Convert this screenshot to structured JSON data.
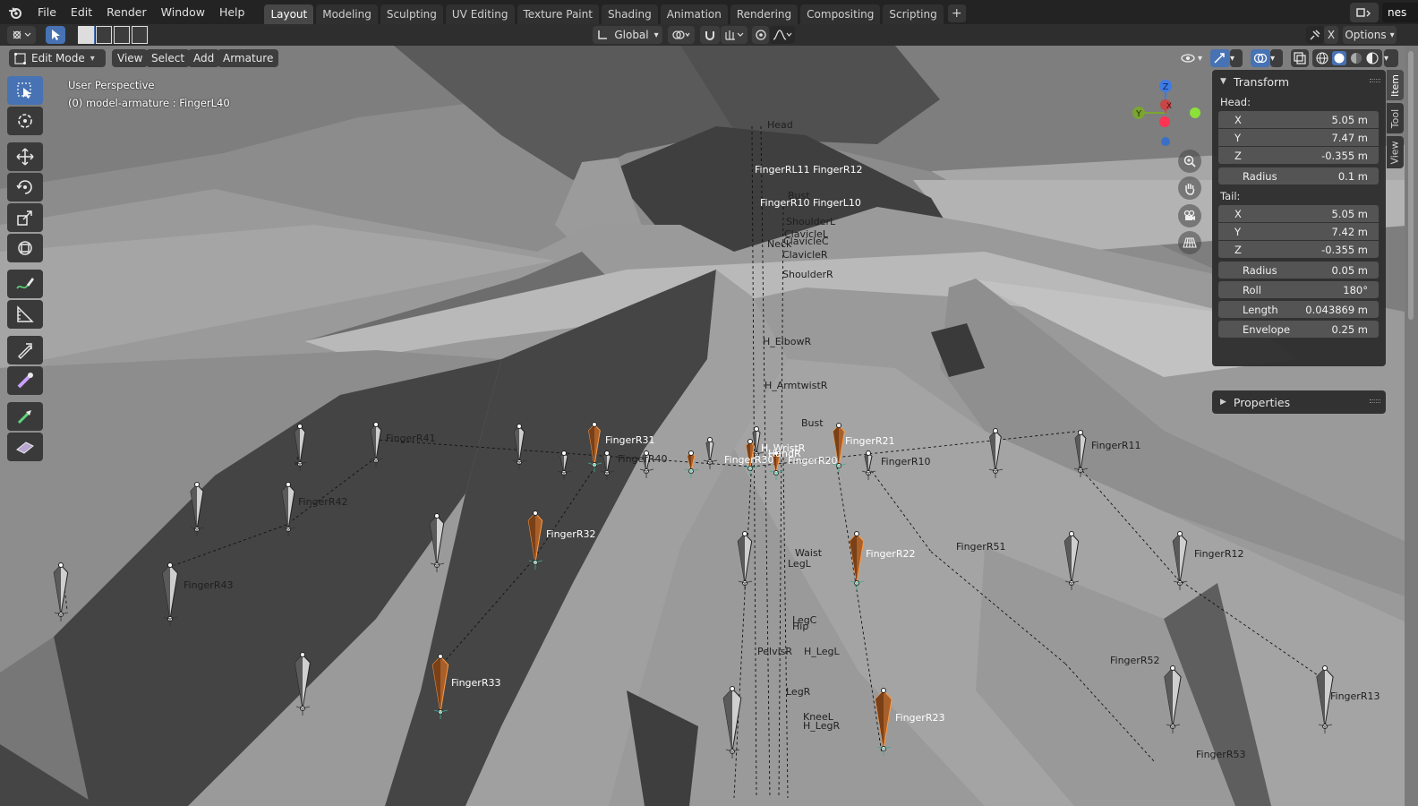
{
  "menu": [
    "File",
    "Edit",
    "Render",
    "Window",
    "Help"
  ],
  "workspaces": [
    {
      "label": "Layout",
      "active": true
    },
    {
      "label": "Modeling",
      "active": false
    },
    {
      "label": "Sculpting",
      "active": false
    },
    {
      "label": "UV Editing",
      "active": false
    },
    {
      "label": "Texture Paint",
      "active": false
    },
    {
      "label": "Shading",
      "active": false
    },
    {
      "label": "Animation",
      "active": false
    },
    {
      "label": "Rendering",
      "active": false
    },
    {
      "label": "Compositing",
      "active": false
    },
    {
      "label": "Scripting",
      "active": false
    }
  ],
  "add_workspace": "+",
  "scene": {
    "name": "nes",
    "close_label": "X",
    "options_label": "Options"
  },
  "header": {
    "transform_orientation": "Global"
  },
  "viewport_header": {
    "mode": "Edit Mode",
    "view": "View",
    "select": "Select",
    "add": "Add",
    "armature": "Armature"
  },
  "viewport_info": {
    "perspective": "User Perspective",
    "object": "(0) model-armature : FingerL40"
  },
  "gizmo_axes": {
    "x": "X",
    "y": "Y",
    "z": "Z"
  },
  "panel": {
    "transform_title": "Transform",
    "head_label": "Head:",
    "head": [
      {
        "axis": "X",
        "value": "5.05 m"
      },
      {
        "axis": "Y",
        "value": "7.47 m"
      },
      {
        "axis": "Z",
        "value": "-0.355 m"
      }
    ],
    "head_radius": {
      "label": "Radius",
      "value": "0.1 m"
    },
    "tail_label": "Tail:",
    "tail": [
      {
        "axis": "X",
        "value": "5.05 m"
      },
      {
        "axis": "Y",
        "value": "7.42 m"
      },
      {
        "axis": "Z",
        "value": "-0.355 m"
      }
    ],
    "tail_radius": {
      "label": "Radius",
      "value": "0.05 m"
    },
    "roll": {
      "label": "Roll",
      "value": "180°"
    },
    "length": {
      "label": "Length",
      "value": "0.043869 m"
    },
    "envelope": {
      "label": "Envelope",
      "value": "0.25 m"
    },
    "properties_title": "Properties"
  },
  "side_tabs": [
    "Item",
    "Tool",
    "View"
  ],
  "bone_labels": {
    "head": "Head",
    "neck_cluster": "FingerRL11 FingerR12",
    "neck_cluster2": "FingerR10 FingerL10",
    "bust_up": "Bust",
    "shoulder_l": "ShoulderL",
    "clavicle_l": "ClavicleL",
    "clavicle_c": "ClavicleC",
    "neck": "Neck",
    "clavicle_r": "ClavicleR",
    "shoulder_r": "ShoulderR",
    "elbow_r": "H_ElbowR",
    "armtwist_r": "H_ArmtwistR",
    "bust": "Bust",
    "wrist_r": "H_WristR",
    "hand_r": "HandR",
    "finger_r41": "FingerR41",
    "finger_r31": "FingerR31",
    "finger_r40": "FingerR40",
    "finger_r30": "FingerR30",
    "finger_r20": "FingerR20",
    "finger_r21": "FingerR21",
    "finger_r10": "FingerR10",
    "finger_r11": "FingerR11",
    "finger_r42": "FingerR42",
    "finger_r32": "FingerR32",
    "finger_r22": "FingerR22",
    "finger_r51": "FingerR51",
    "finger_r12": "FingerR12",
    "finger_r43": "FingerR43",
    "waist": "Waist",
    "leg_l": "LegL",
    "leg_c": "LegC",
    "hip": "Hip",
    "pelvis": "PelvisR",
    "h_leg_l": "H_LegL",
    "finger_r33": "FingerR33",
    "finger_r52": "FingerR52",
    "finger_r13": "FingerR13",
    "leg_r": "LegR",
    "knee_l": "KneeL",
    "h_leg_r": "H_LegR",
    "finger_r23": "FingerR23",
    "finger_r53": "FingerR53"
  }
}
